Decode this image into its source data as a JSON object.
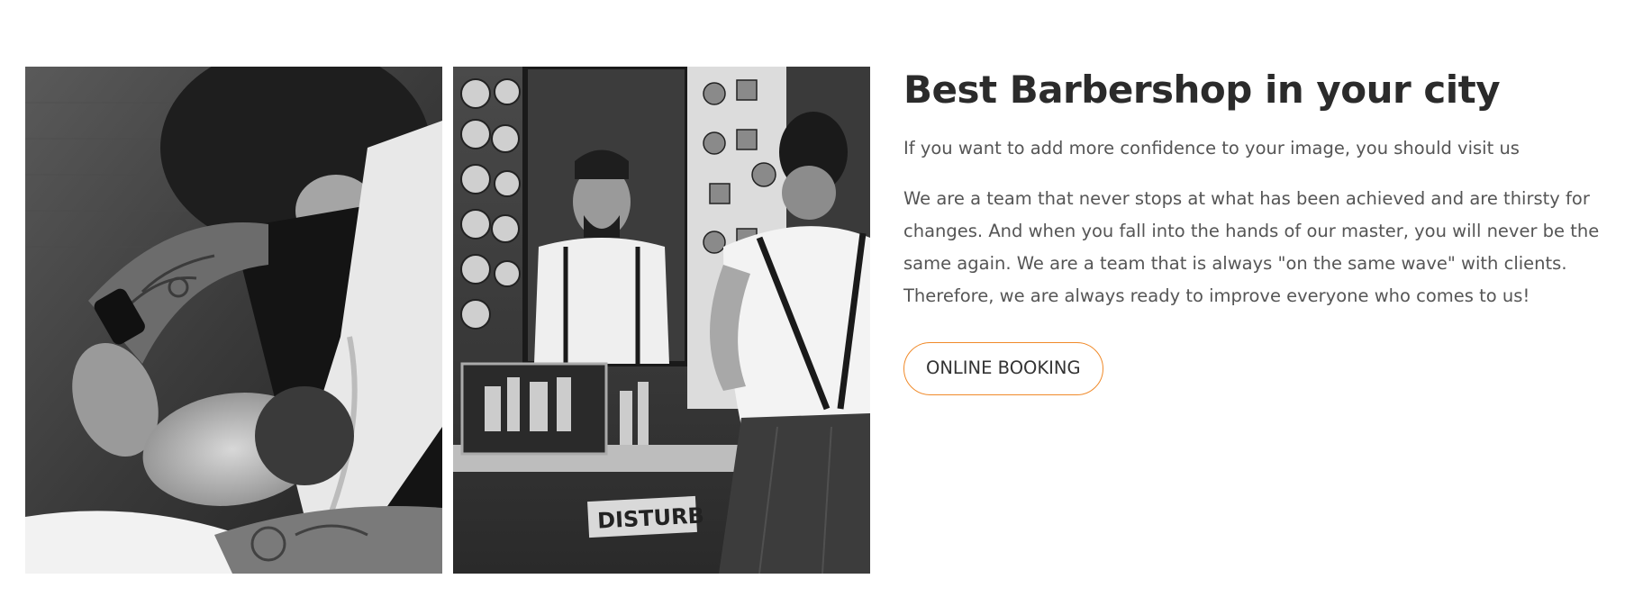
{
  "section": {
    "title": "Best Barbershop in your city",
    "subtitle": "If you want to add more confidence to your image, you should visit us",
    "body": "We are a team that never stops at what has been achieved and are thirsty for changes. And when you fall into the hands of our master, you will never be the same again. We are a team that is always \"on the same wave\" with clients. Therefore, we are always ready to improve everyone who comes to us!",
    "button_label": "ONLINE BOOKING"
  },
  "images": {
    "photo_1": "barber-shaving-client-photo",
    "photo_2": "barber-mirror-reflection-photo",
    "photo_2_sign_text": "DISTURB"
  },
  "colors": {
    "accent": "#f08a2a",
    "title": "#2b2b2b",
    "text": "#555555",
    "background": "#ffffff"
  }
}
